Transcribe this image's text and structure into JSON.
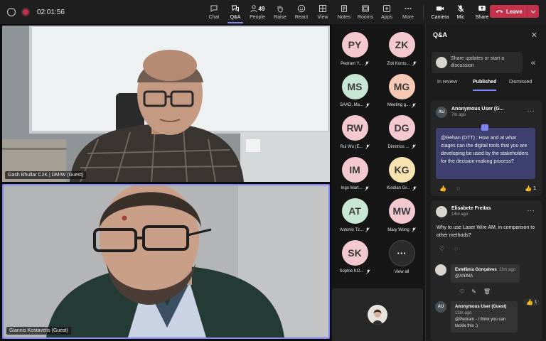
{
  "toolbar": {
    "timer": "02:01:56",
    "buttons": [
      {
        "id": "chat",
        "label": "Chat"
      },
      {
        "id": "qa",
        "label": "Q&A"
      },
      {
        "id": "people",
        "label": "People",
        "count": "49"
      },
      {
        "id": "raise",
        "label": "Raise"
      },
      {
        "id": "react",
        "label": "React"
      },
      {
        "id": "view",
        "label": "View"
      },
      {
        "id": "notes",
        "label": "Notes"
      },
      {
        "id": "rooms",
        "label": "Rooms"
      },
      {
        "id": "apps",
        "label": "Apps"
      },
      {
        "id": "more",
        "label": "More"
      },
      {
        "id": "camera",
        "label": "Camera"
      },
      {
        "id": "mic",
        "label": "Mic"
      },
      {
        "id": "share",
        "label": "Share"
      }
    ],
    "leave_label": "Leave"
  },
  "stage": {
    "tile1_name": "Gash Bhullar C2K | DMIW (Guest)",
    "tile2_name": "Giannis Kostavelis (Guest)"
  },
  "gallery": {
    "participants": [
      {
        "initials": "PY",
        "name": "Pedram Y...",
        "color": "#f3c9cf"
      },
      {
        "initials": "ZK",
        "name": "Zoli Konto...",
        "color": "#f3c9cf"
      },
      {
        "initials": "MS",
        "name": "SAAD, Ma...",
        "color": "#c7e6d3"
      },
      {
        "initials": "MG",
        "name": "Meeting g...",
        "color": "#f6c9b6"
      },
      {
        "initials": "RW",
        "name": "Rui Wu (E...",
        "color": "#f3c9cf"
      },
      {
        "initials": "DG",
        "name": "Dimitrios ...",
        "color": "#f3c9cf"
      },
      {
        "initials": "IM",
        "name": "Ingo Mart...",
        "color": "#f3c9cf"
      },
      {
        "initials": "KG",
        "name": "Kiodian Gr...",
        "color": "#f7e3b0"
      },
      {
        "initials": "AT",
        "name": "Antonis Tz...",
        "color": "#c7e6d3"
      },
      {
        "initials": "MW",
        "name": "Mary Wong",
        "color": "#f3c9cf"
      },
      {
        "initials": "SK",
        "name": "Sophie KO...",
        "color": "#f3c9cf"
      }
    ],
    "view_all_label": "View all",
    "view_all_glyph": "···"
  },
  "qa": {
    "title": "Q&A",
    "share_placeholder": "Share updates or start a discussion",
    "tabs": [
      "In review",
      "Published",
      "Dismissed"
    ],
    "active_tab": "Published",
    "questions": [
      {
        "avatar": "AU",
        "author": "Anonymous User (G...",
        "time": "7m ago",
        "text": "@Rehan (DTT) : How and at what stages can the digital tools that you are developing be used by the stakeholders for the decision-making process?",
        "likes": "1"
      },
      {
        "author": "Elisabete Freitas",
        "time": "14m ago",
        "text": "Why to use Laser Wire AM, in comparison to other methods?",
        "replies": [
          {
            "author": "Estefânia Gonçalves",
            "time": "13m ago",
            "text": "@ANIMA"
          },
          {
            "avatar": "AU",
            "author": "Anonymous User (Guest)",
            "time": "12m ago",
            "text": "@Pedram - I think you can tackle this :)",
            "likes": "1"
          }
        ]
      }
    ]
  }
}
